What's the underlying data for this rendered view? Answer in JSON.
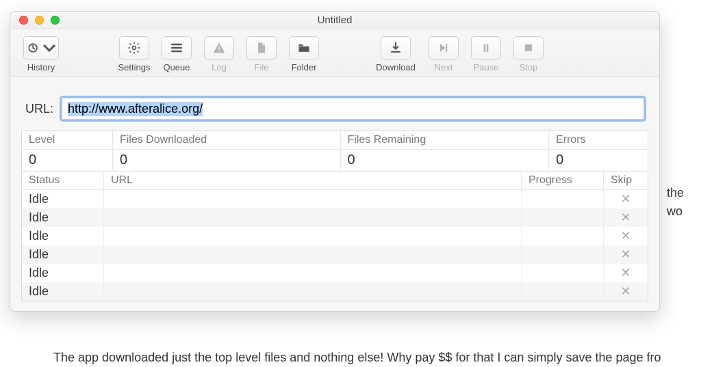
{
  "window": {
    "title": "Untitled"
  },
  "toolbar": {
    "history": "History",
    "settings": "Settings",
    "queue": "Queue",
    "log": "Log",
    "file": "File",
    "folder": "Folder",
    "download": "Download",
    "next": "Next",
    "pause": "Pause",
    "stop": "Stop"
  },
  "url": {
    "label": "URL:",
    "value": "http://www.afteralice.org/"
  },
  "stats": {
    "headers": {
      "level": "Level",
      "filesDownloaded": "Files Downloaded",
      "filesRemaining": "Files Remaining",
      "errors": "Errors"
    },
    "values": {
      "level": "0",
      "filesDownloaded": "0",
      "filesRemaining": "0",
      "errors": "0"
    }
  },
  "queue": {
    "headers": {
      "status": "Status",
      "url": "URL",
      "progress": "Progress",
      "skip": "Skip"
    },
    "rows": [
      {
        "status": "Idle",
        "url": "",
        "progress": ""
      },
      {
        "status": "Idle",
        "url": "",
        "progress": ""
      },
      {
        "status": "Idle",
        "url": "",
        "progress": ""
      },
      {
        "status": "Idle",
        "url": "",
        "progress": ""
      },
      {
        "status": "Idle",
        "url": "",
        "progress": ""
      },
      {
        "status": "Idle",
        "url": "",
        "progress": ""
      }
    ]
  },
  "background": {
    "line1a": "the",
    "line1b": "wo",
    "line2": "The app downloaded just the top level files and nothing else! Why pay $$ for that I can simply save the page fro"
  },
  "icons": {
    "skip": "✕"
  }
}
